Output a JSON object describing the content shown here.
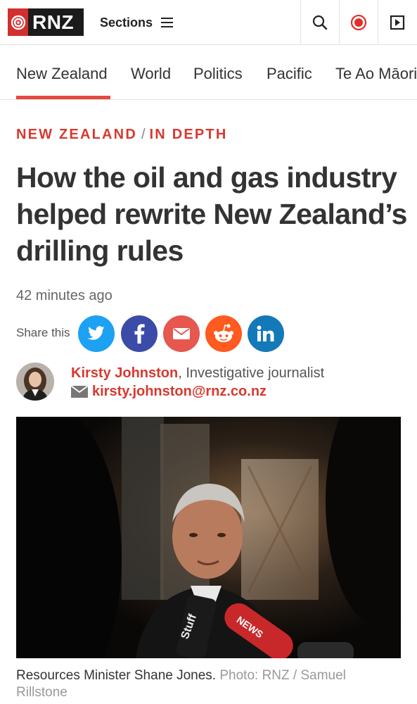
{
  "header": {
    "logo_text": "RNZ",
    "sections_label": "Sections",
    "icons": [
      "search-icon",
      "live-radio-icon",
      "play-icon"
    ]
  },
  "nav": {
    "items": [
      "New Zealand",
      "World",
      "Politics",
      "Pacific",
      "Te Ao Māori"
    ],
    "active_index": 0
  },
  "article": {
    "kicker_primary": "NEW ZEALAND",
    "kicker_separator": "/",
    "kicker_secondary": "IN DEPTH",
    "headline": "How the oil and gas industry helped rewrite New Zealand’s drilling rules",
    "timestamp": "42 minutes ago",
    "share_label": "Share this",
    "share_buttons": [
      {
        "name": "twitter",
        "color": "#1da1f2"
      },
      {
        "name": "facebook",
        "color": "#3b4ba8"
      },
      {
        "name": "email",
        "color": "#e5574f"
      },
      {
        "name": "reddit",
        "color": "#ff5a1f"
      },
      {
        "name": "linkedin",
        "color": "#1479b8"
      }
    ],
    "author_name": "Kirsty Johnston",
    "author_role": ", Investigative journalist",
    "author_email": "kirsty.johnston@rnz.co.nz",
    "caption_text": "Resources Minister Shane Jones.",
    "caption_credit": "Photo: RNZ / Samuel Rillstone"
  },
  "colors": {
    "accent": "#d8392f",
    "logo_bg": "#1b1b1b",
    "logo_red": "#d32f2f"
  }
}
